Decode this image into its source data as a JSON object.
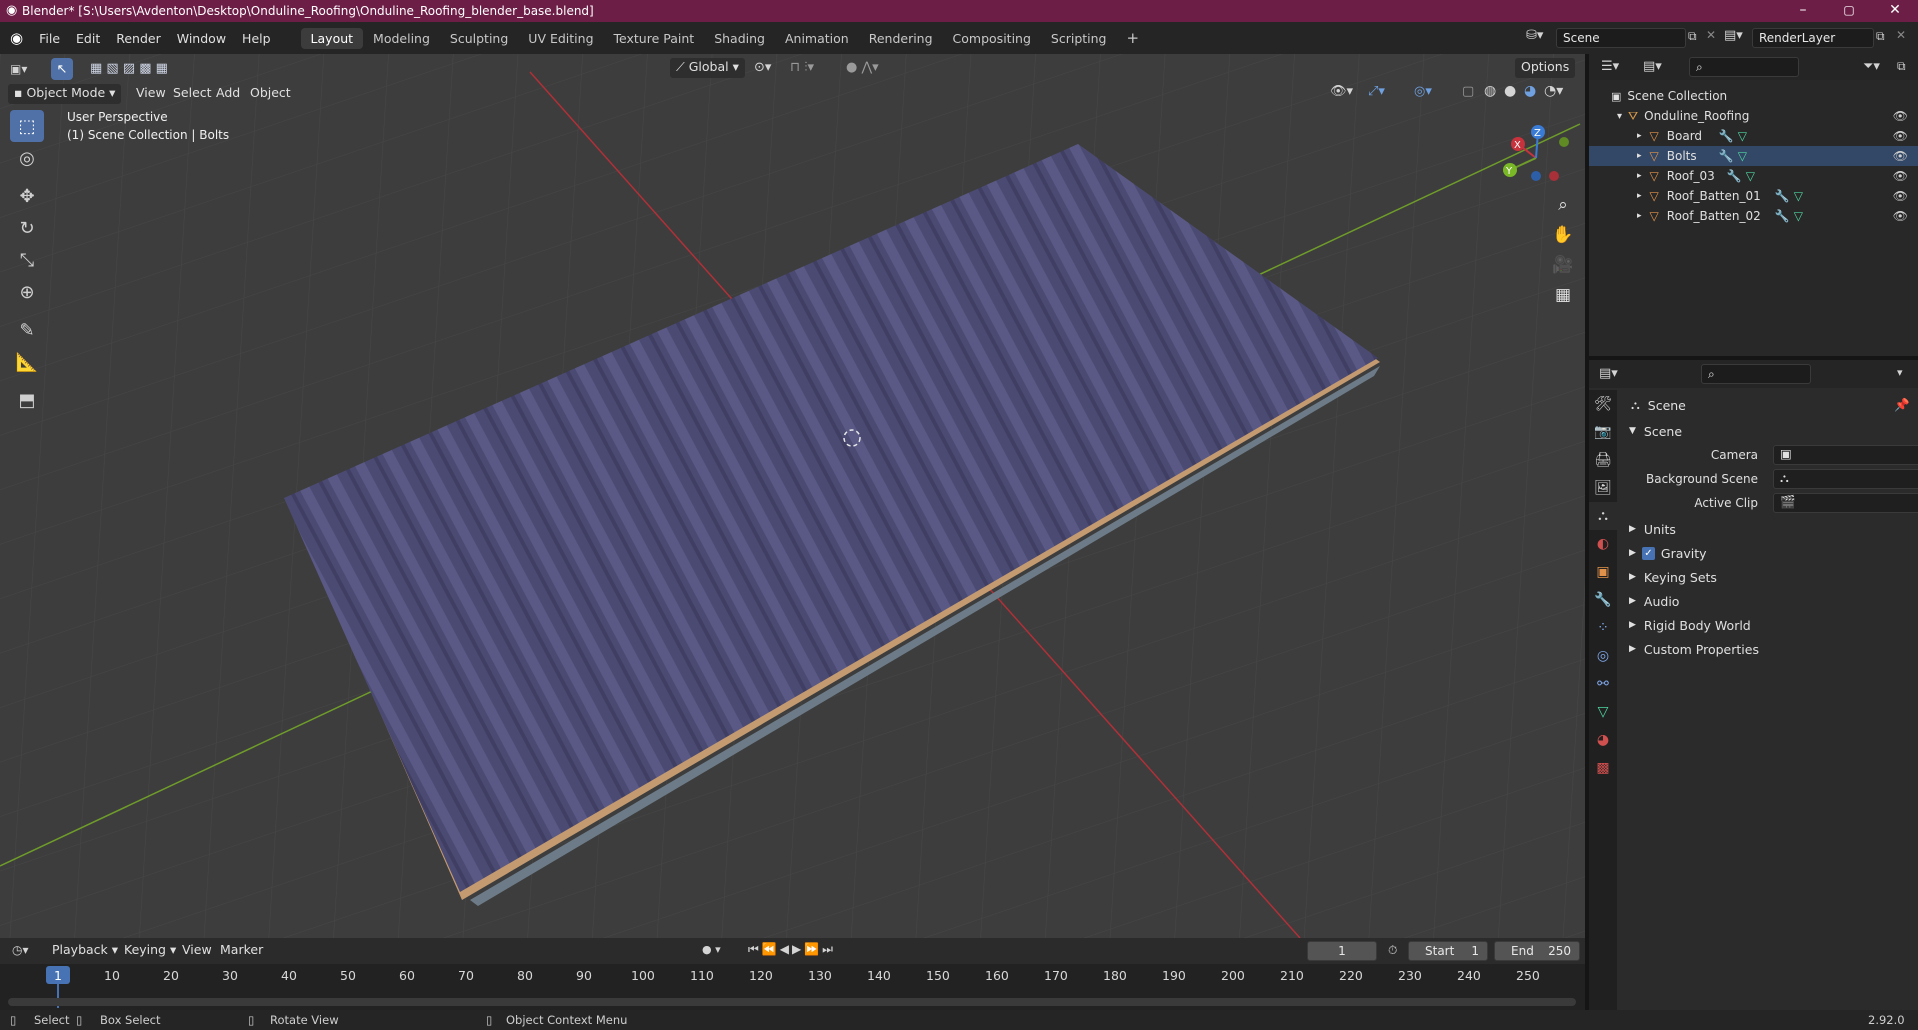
{
  "window": {
    "title": "Blender* [S:\\Users\\Avdenton\\Desktop\\Onduline_Roofing\\Onduline_Roofing_blender_base.blend]",
    "minimize": "–",
    "maximize": "▢",
    "close": "✕"
  },
  "menu": [
    "File",
    "Edit",
    "Render",
    "Window",
    "Help"
  ],
  "workspaces": [
    "Layout",
    "Modeling",
    "Sculpting",
    "UV Editing",
    "Texture Paint",
    "Shading",
    "Animation",
    "Rendering",
    "Compositing",
    "Scripting"
  ],
  "active_workspace": "Layout",
  "scene_field": "Scene",
  "render_layer_field": "RenderLayer",
  "viewport": {
    "mode": "Object Mode",
    "menus": [
      "View",
      "Select",
      "Add",
      "Object"
    ],
    "transform_orientation": "Global",
    "options": "Options",
    "info_line1": "User Perspective",
    "info_line2": "(1) Scene Collection | Bolts",
    "gizmo_labels": {
      "x": "X",
      "y": "Y",
      "z": "Z"
    }
  },
  "outliner": {
    "root": "Scene Collection",
    "collection": "Onduline_Roofing",
    "items": [
      "Board",
      "Bolts",
      "Roof_03",
      "Roof_Batten_01",
      "Roof_Batten_02"
    ]
  },
  "properties": {
    "header": "Scene",
    "panel": "Scene",
    "camera_label": "Camera",
    "background_label": "Background Scene",
    "clip_label": "Active Clip",
    "sections": [
      "Units",
      "Gravity",
      "Keying Sets",
      "Audio",
      "Rigid Body World",
      "Custom Properties"
    ],
    "gravity_checked": true
  },
  "timeline": {
    "menus": [
      "Playback",
      "Keying",
      "View",
      "Marker"
    ],
    "current_frame": "1",
    "start_label": "Start",
    "start": "1",
    "end_label": "End",
    "end": "250",
    "ruler": [
      "1",
      "10",
      "20",
      "30",
      "40",
      "50",
      "60",
      "70",
      "80",
      "90",
      "100",
      "110",
      "120",
      "130",
      "140",
      "150",
      "160",
      "170",
      "180",
      "190",
      "200",
      "210",
      "220",
      "230",
      "240",
      "250"
    ]
  },
  "status": {
    "select": "Select",
    "box_select": "Box Select",
    "rotate": "Rotate View",
    "context": "Object Context Menu",
    "version": "2.92.0"
  },
  "colors": {
    "title_bar": "#6d1e47",
    "roof": "#4e4d78",
    "active_tool": "#5071a8",
    "x_axis": "#c8323c",
    "y_axis": "#6a9a2a"
  }
}
